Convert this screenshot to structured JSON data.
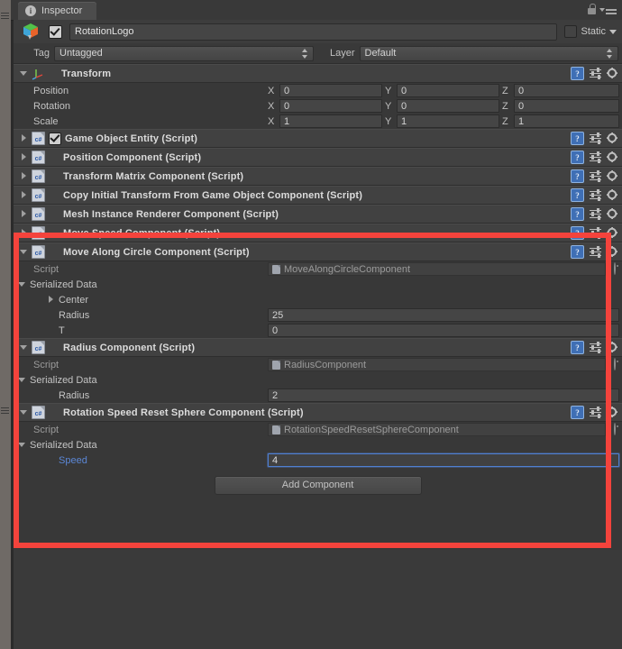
{
  "window": {
    "tab_label": "Inspector",
    "tab_icon": "info-icon",
    "lock_icon": "lock-icon",
    "menu_icon": "hamburger-menu-icon",
    "accent_highlight_color": "#f4433c",
    "background_color": "#383838"
  },
  "game_object": {
    "icon": "prefab-cube-icon",
    "enabled": true,
    "name": "RotationLogo",
    "static_label": "Static",
    "static_checked": false,
    "tag_label": "Tag",
    "tag_value": "Untagged",
    "layer_label": "Layer",
    "layer_value": "Default"
  },
  "transform": {
    "title": "Transform",
    "expanded": true,
    "rows": [
      {
        "label": "Position",
        "x": "0",
        "y": "0",
        "z": "0"
      },
      {
        "label": "Rotation",
        "x": "0",
        "y": "0",
        "z": "0"
      },
      {
        "label": "Scale",
        "x": "1",
        "y": "1",
        "z": "1"
      }
    ],
    "axis_labels": {
      "x": "X",
      "y": "Y",
      "z": "Z"
    }
  },
  "collapsed_components": [
    {
      "title": "Game Object Entity (Script)",
      "has_checkbox": true,
      "checked": true
    },
    {
      "title": "Position Component (Script)",
      "has_checkbox": false,
      "checked": false
    },
    {
      "title": "Transform Matrix Component (Script)",
      "has_checkbox": false,
      "checked": false
    },
    {
      "title": "Copy Initial Transform From Game Object Component (Script)",
      "has_checkbox": false,
      "checked": false
    },
    {
      "title": "Mesh Instance Renderer Component (Script)",
      "has_checkbox": false,
      "checked": false
    },
    {
      "title": "Move Speed Component (Script)",
      "has_checkbox": false,
      "checked": false
    }
  ],
  "expanded_components": [
    {
      "title": "Move Along Circle Component (Script)",
      "script_label": "Script",
      "script_value": "MoveAlongCircleComponent",
      "serialized_label": "Serialized Data",
      "fields": [
        {
          "label": "Center",
          "value": "",
          "kind": "foldout"
        },
        {
          "label": "Radius",
          "value": "25",
          "kind": "number"
        },
        {
          "label": "T",
          "value": "0",
          "kind": "number"
        }
      ]
    },
    {
      "title": "Radius Component (Script)",
      "script_label": "Script",
      "script_value": "RadiusComponent",
      "serialized_label": "Serialized Data",
      "fields": [
        {
          "label": "Radius",
          "value": "2",
          "kind": "number"
        }
      ]
    },
    {
      "title": "Rotation Speed Reset Sphere Component (Script)",
      "script_label": "Script",
      "script_value": "RotationSpeedResetSphereComponent",
      "serialized_label": "Serialized Data",
      "fields": [
        {
          "label": "Speed",
          "value": "4",
          "kind": "number",
          "focused": true
        }
      ]
    }
  ],
  "header_icons": {
    "help": "?",
    "help_name": "help-icon",
    "preset_name": "preset-sliders-icon",
    "gear_name": "gear-icon"
  },
  "add_component": {
    "label": "Add Component"
  }
}
